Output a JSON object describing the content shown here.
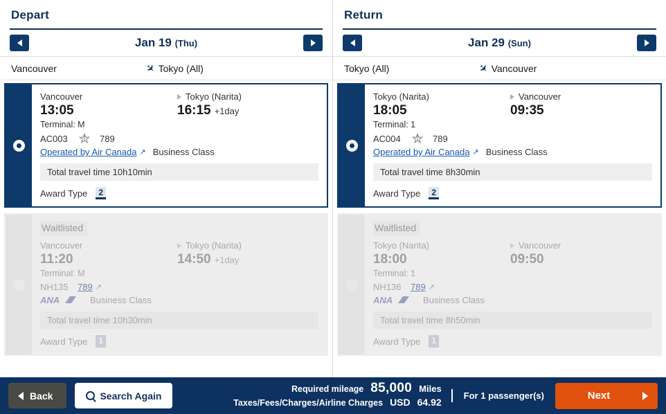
{
  "columns": [
    {
      "title": "Depart",
      "date": "Jan 19",
      "weekday": "(Thu)",
      "prev_label": "◀",
      "next_label": "▶",
      "route_from": "Vancouver",
      "route_to": "Tokyo (All)",
      "flights": [
        {
          "selected": true,
          "status": "",
          "dep_city": "Vancouver",
          "arr_city": "Tokyo (Narita)",
          "dep_time": "13:05",
          "arr_time": "16:15",
          "day_offset": "+1day",
          "terminal": "Terminal: M",
          "flight_no": "AC003",
          "alliance_icon": "star-alliance-icon",
          "equipment": "789",
          "operator": "Operated by Air Canada",
          "external_icon": "external-link-icon",
          "cabin": "Business Class",
          "travel_time_label": "Total travel time",
          "travel_time": "10h10min",
          "award_label": "Award Type",
          "award_value": "2"
        },
        {
          "selected": false,
          "status": "Waitlisted",
          "dep_city": "Vancouver",
          "arr_city": "Tokyo (Narita)",
          "dep_time": "11:20",
          "arr_time": "14:50",
          "day_offset": "+1day",
          "terminal": "Terminal: M",
          "flight_no": "NH135",
          "alliance_icon": "",
          "equipment": "789",
          "external_icon": "external-link-icon",
          "carrier_logo": "ana-logo",
          "cabin": "Business Class",
          "travel_time_label": "Total travel time",
          "travel_time": "10h30min",
          "award_label": "Award Type",
          "award_value": "1"
        }
      ]
    },
    {
      "title": "Return",
      "date": "Jan 29",
      "weekday": "(Sun)",
      "prev_label": "◀",
      "next_label": "▶",
      "route_from": "Tokyo (All)",
      "route_to": "Vancouver",
      "flights": [
        {
          "selected": true,
          "status": "",
          "dep_city": "Tokyo (Narita)",
          "arr_city": "Vancouver",
          "dep_time": "18:05",
          "arr_time": "09:35",
          "day_offset": "",
          "terminal": "Terminal: 1",
          "flight_no": "AC004",
          "alliance_icon": "star-alliance-icon",
          "equipment": "789",
          "operator": "Operated by Air Canada",
          "external_icon": "external-link-icon",
          "cabin": "Business Class",
          "travel_time_label": "Total travel time",
          "travel_time": "8h30min",
          "award_label": "Award Type",
          "award_value": "2"
        },
        {
          "selected": false,
          "status": "Waitlisted",
          "dep_city": "Tokyo (Narita)",
          "arr_city": "Vancouver",
          "dep_time": "18:00",
          "arr_time": "09:50",
          "day_offset": "",
          "terminal": "Terminal: 1",
          "flight_no": "NH136",
          "alliance_icon": "",
          "equipment": "789",
          "external_icon": "external-link-icon",
          "carrier_logo": "ana-logo",
          "cabin": "Business Class",
          "travel_time_label": "Total travel time",
          "travel_time": "8h50min",
          "award_label": "Award Type",
          "award_value": "1"
        }
      ]
    }
  ],
  "bottombar": {
    "back_label": "Back",
    "search_label": "Search Again",
    "mileage_label": "Required mileage",
    "mileage_value": "85,000",
    "mileage_unit": "Miles",
    "taxes_label": "Taxes/Fees/Charges/Airline Charges",
    "taxes_currency": "USD",
    "taxes_value": "64.92",
    "passengers": "For 1 passenger(s)",
    "next_label": "Next"
  },
  "colors": {
    "navy": "#0d3160",
    "card_navy": "#0d3a6b",
    "accent_orange": "#e0510e",
    "link_blue": "#1558b0",
    "back_gray": "#4a4a45",
    "waitlist_gray": "#ededed"
  }
}
